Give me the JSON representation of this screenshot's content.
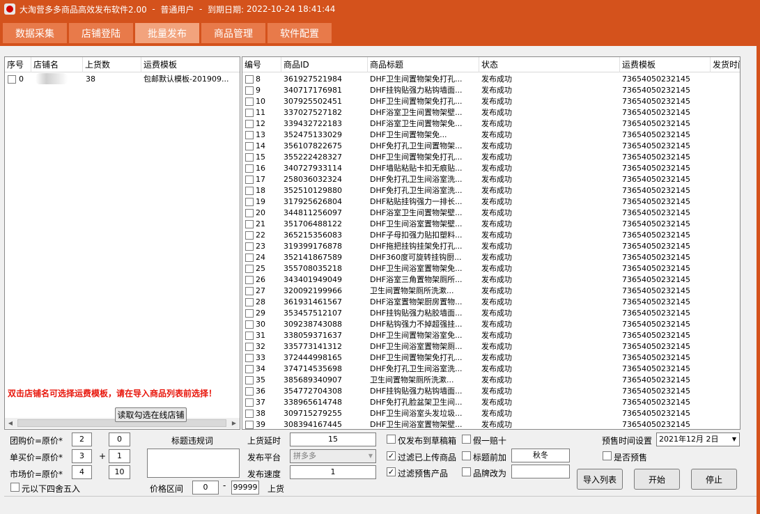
{
  "titlebar": {
    "app_name": "大淘营多多商品高效发布软件2.00",
    "sep1": "  -  ",
    "user_type": "普通用户",
    "sep2": "  -  ",
    "expiry_label": "到期日期:",
    "expiry_value": "2022-10-24 18:41:44"
  },
  "tabs": [
    {
      "label": "数据采集"
    },
    {
      "label": "店铺登陆"
    },
    {
      "label": "批量发布"
    },
    {
      "label": "商品管理"
    },
    {
      "label": "软件配置"
    }
  ],
  "shop_table": {
    "headers": [
      "序号",
      "店铺名",
      "上货数",
      "运费模板"
    ],
    "rows": [
      {
        "index": "0",
        "shop_name": "",
        "count": "38",
        "template": "包邮默认模板-201909..."
      }
    ]
  },
  "notice": "双击店铺名可选择运费模板，请在导入商品列表前选择！",
  "read_button": "读取勾选在线店铺",
  "product_table": {
    "headers": [
      "编号",
      "商品ID",
      "商品标题",
      "状态",
      "运费模板",
      "发货时间"
    ],
    "rows": [
      {
        "no": "8",
        "id": "361927521984",
        "title": "DHF卫生间置物架免打孔...",
        "status": "发布成功",
        "template": "73654050232145"
      },
      {
        "no": "9",
        "id": "340717176981",
        "title": "DHF挂钩贴强力粘钩墙面...",
        "status": "发布成功",
        "template": "73654050232145"
      },
      {
        "no": "10",
        "id": "307925502451",
        "title": "DHF卫生间置物架免打孔...",
        "status": "发布成功",
        "template": "73654050232145"
      },
      {
        "no": "11",
        "id": "337027527182",
        "title": "DHF浴室卫生间置物架壁...",
        "status": "发布成功",
        "template": "73654050232145"
      },
      {
        "no": "12",
        "id": "339432722183",
        "title": "DHF浴室卫生间置物架免...",
        "status": "发布成功",
        "template": "73654050232145"
      },
      {
        "no": "13",
        "id": "352475133029",
        "title": "DHF卫生间置物架免...",
        "status": "发布成功",
        "template": "73654050232145"
      },
      {
        "no": "14",
        "id": "356107822675",
        "title": "DHF免打孔卫生间置物架...",
        "status": "发布成功",
        "template": "73654050232145"
      },
      {
        "no": "15",
        "id": "355222428327",
        "title": "DHF卫生间置物架免打孔...",
        "status": "发布成功",
        "template": "73654050232145"
      },
      {
        "no": "16",
        "id": "340727933114",
        "title": "DHF墙贴粘贴卡扣无痕贴...",
        "status": "发布成功",
        "template": "73654050232145"
      },
      {
        "no": "17",
        "id": "258036032324",
        "title": "DHF免打孔卫生间浴室洗...",
        "status": "发布成功",
        "template": "73654050232145"
      },
      {
        "no": "18",
        "id": "352510129880",
        "title": "DHF免打孔卫生间浴室洗...",
        "status": "发布成功",
        "template": "73654050232145"
      },
      {
        "no": "19",
        "id": "317925626804",
        "title": "DHF粘贴挂钩强力一排长...",
        "status": "发布成功",
        "template": "73654050232145"
      },
      {
        "no": "20",
        "id": "344811256097",
        "title": "DHF浴室卫生间置物架壁...",
        "status": "发布成功",
        "template": "73654050232145"
      },
      {
        "no": "21",
        "id": "351706488122",
        "title": "DHF卫生间浴室置物架壁...",
        "status": "发布成功",
        "template": "73654050232145"
      },
      {
        "no": "22",
        "id": "365215356083",
        "title": "DHF子母扣强力贴扣塑料...",
        "status": "发布成功",
        "template": "73654050232145"
      },
      {
        "no": "23",
        "id": "319399176878",
        "title": "DHF拖把挂钩挂架免打孔...",
        "status": "发布成功",
        "template": "73654050232145"
      },
      {
        "no": "24",
        "id": "352141867589",
        "title": "DHF360度可旋转挂钩厨...",
        "status": "发布成功",
        "template": "73654050232145"
      },
      {
        "no": "25",
        "id": "355708035218",
        "title": "DHF卫生间浴室置物架免...",
        "status": "发布成功",
        "template": "73654050232145"
      },
      {
        "no": "26",
        "id": "343401949049",
        "title": "DHF浴室三角置物架厕所...",
        "status": "发布成功",
        "template": "73654050232145"
      },
      {
        "no": "27",
        "id": "320092199966",
        "title": "卫生间置物架厕所洗漱...",
        "status": "发布成功",
        "template": "73654050232145"
      },
      {
        "no": "28",
        "id": "361931461567",
        "title": "DHF浴室置物架厨房置物...",
        "status": "发布成功",
        "template": "73654050232145"
      },
      {
        "no": "29",
        "id": "353457512107",
        "title": "DHF挂钩贴强力粘胶墙面...",
        "status": "发布成功",
        "template": "73654050232145"
      },
      {
        "no": "30",
        "id": "309238743088",
        "title": "DHF粘钩强力不掉超强挂...",
        "status": "发布成功",
        "template": "73654050232145"
      },
      {
        "no": "31",
        "id": "338059371637",
        "title": "DHF卫生间置物架浴室免...",
        "status": "发布成功",
        "template": "73654050232145"
      },
      {
        "no": "32",
        "id": "335773141312",
        "title": "DHF卫生间浴室置物架厕...",
        "status": "发布成功",
        "template": "73654050232145"
      },
      {
        "no": "33",
        "id": "372444998165",
        "title": "DHF卫生间置物架免打孔...",
        "status": "发布成功",
        "template": "73654050232145"
      },
      {
        "no": "34",
        "id": "374714535698",
        "title": "DHF免打孔卫生间浴室洗...",
        "status": "发布成功",
        "template": "73654050232145"
      },
      {
        "no": "35",
        "id": "385689340907",
        "title": "卫生间置物架厕所洗漱...",
        "status": "发布成功",
        "template": "73654050232145"
      },
      {
        "no": "36",
        "id": "354772704308",
        "title": "DHF挂钩贴强力粘钩墙面...",
        "status": "发布成功",
        "template": "73654050232145"
      },
      {
        "no": "37",
        "id": "338965614748",
        "title": "DHF免打孔脸盆架卫生间...",
        "status": "发布成功",
        "template": "73654050232145"
      },
      {
        "no": "38",
        "id": "309715279255",
        "title": "DHF卫生间浴室头发垃圾...",
        "status": "发布成功",
        "template": "73654050232145"
      },
      {
        "no": "39",
        "id": "308394167445",
        "title": "DHF卫生间浴室置物架壁...",
        "status": "发布成功",
        "template": "73654050232145"
      }
    ]
  },
  "pricing": {
    "group_label": "团购价=原价*",
    "group_mult": "2",
    "group_add": "0",
    "single_label": "单买价=原价*",
    "single_mult": "3",
    "plus_sign": "+",
    "single_add": "1",
    "market_label": "市场价=原价*",
    "market_mult": "4",
    "market_add": "10",
    "round_label": "元以下四舍五入"
  },
  "title_rules_label": "标题违规词",
  "price_range_label": "价格区间",
  "price_min": "0",
  "price_dash": "-",
  "price_max": "99999",
  "price_suffix": "上货",
  "upload": {
    "delay_label": "上货延时",
    "delay_value": "15",
    "platform_label": "发布平台",
    "platform_value": "拼多多",
    "speed_label": "发布速度",
    "speed_value": "1"
  },
  "options": {
    "draft_label": "仅发布到草稿箱",
    "filter_uploaded_label": "过滤已上传商品",
    "filter_presale_label": "过滤预售产品",
    "fake_label": "假一赔十",
    "title_prefix_label": "标题前加",
    "title_prefix_value": "秋冬",
    "brand_label": "品牌改为",
    "brand_value": ""
  },
  "presale": {
    "time_label": "预售时间设置",
    "date_value": "2021年12月 2日",
    "is_presale_label": "是否预售"
  },
  "buttons": {
    "import": "导入列表",
    "start": "开始",
    "stop": "停止"
  },
  "colors": {
    "brand": "#d4521c",
    "tab": "#e87a4a",
    "tab_active": "#f2a37d",
    "notice": "#e8170c"
  }
}
